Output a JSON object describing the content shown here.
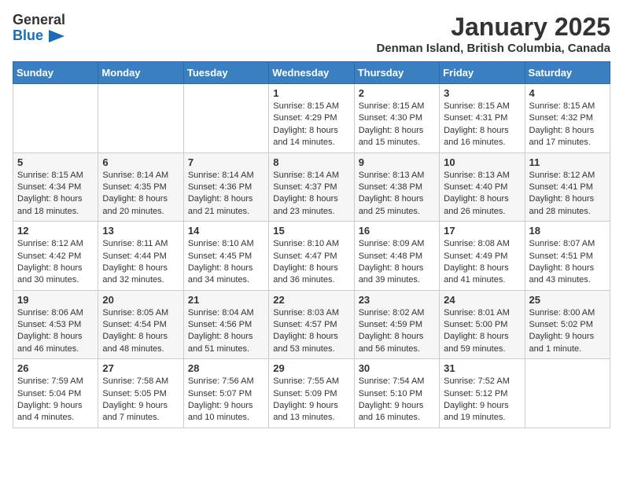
{
  "header": {
    "logo_general": "General",
    "logo_blue": "Blue",
    "month": "January 2025",
    "location": "Denman Island, British Columbia, Canada"
  },
  "weekdays": [
    "Sunday",
    "Monday",
    "Tuesday",
    "Wednesday",
    "Thursday",
    "Friday",
    "Saturday"
  ],
  "weeks": [
    [
      {
        "day": "",
        "info": ""
      },
      {
        "day": "",
        "info": ""
      },
      {
        "day": "",
        "info": ""
      },
      {
        "day": "1",
        "info": "Sunrise: 8:15 AM\nSunset: 4:29 PM\nDaylight: 8 hours\nand 14 minutes."
      },
      {
        "day": "2",
        "info": "Sunrise: 8:15 AM\nSunset: 4:30 PM\nDaylight: 8 hours\nand 15 minutes."
      },
      {
        "day": "3",
        "info": "Sunrise: 8:15 AM\nSunset: 4:31 PM\nDaylight: 8 hours\nand 16 minutes."
      },
      {
        "day": "4",
        "info": "Sunrise: 8:15 AM\nSunset: 4:32 PM\nDaylight: 8 hours\nand 17 minutes."
      }
    ],
    [
      {
        "day": "5",
        "info": "Sunrise: 8:15 AM\nSunset: 4:34 PM\nDaylight: 8 hours\nand 18 minutes."
      },
      {
        "day": "6",
        "info": "Sunrise: 8:14 AM\nSunset: 4:35 PM\nDaylight: 8 hours\nand 20 minutes."
      },
      {
        "day": "7",
        "info": "Sunrise: 8:14 AM\nSunset: 4:36 PM\nDaylight: 8 hours\nand 21 minutes."
      },
      {
        "day": "8",
        "info": "Sunrise: 8:14 AM\nSunset: 4:37 PM\nDaylight: 8 hours\nand 23 minutes."
      },
      {
        "day": "9",
        "info": "Sunrise: 8:13 AM\nSunset: 4:38 PM\nDaylight: 8 hours\nand 25 minutes."
      },
      {
        "day": "10",
        "info": "Sunrise: 8:13 AM\nSunset: 4:40 PM\nDaylight: 8 hours\nand 26 minutes."
      },
      {
        "day": "11",
        "info": "Sunrise: 8:12 AM\nSunset: 4:41 PM\nDaylight: 8 hours\nand 28 minutes."
      }
    ],
    [
      {
        "day": "12",
        "info": "Sunrise: 8:12 AM\nSunset: 4:42 PM\nDaylight: 8 hours\nand 30 minutes."
      },
      {
        "day": "13",
        "info": "Sunrise: 8:11 AM\nSunset: 4:44 PM\nDaylight: 8 hours\nand 32 minutes."
      },
      {
        "day": "14",
        "info": "Sunrise: 8:10 AM\nSunset: 4:45 PM\nDaylight: 8 hours\nand 34 minutes."
      },
      {
        "day": "15",
        "info": "Sunrise: 8:10 AM\nSunset: 4:47 PM\nDaylight: 8 hours\nand 36 minutes."
      },
      {
        "day": "16",
        "info": "Sunrise: 8:09 AM\nSunset: 4:48 PM\nDaylight: 8 hours\nand 39 minutes."
      },
      {
        "day": "17",
        "info": "Sunrise: 8:08 AM\nSunset: 4:49 PM\nDaylight: 8 hours\nand 41 minutes."
      },
      {
        "day": "18",
        "info": "Sunrise: 8:07 AM\nSunset: 4:51 PM\nDaylight: 8 hours\nand 43 minutes."
      }
    ],
    [
      {
        "day": "19",
        "info": "Sunrise: 8:06 AM\nSunset: 4:53 PM\nDaylight: 8 hours\nand 46 minutes."
      },
      {
        "day": "20",
        "info": "Sunrise: 8:05 AM\nSunset: 4:54 PM\nDaylight: 8 hours\nand 48 minutes."
      },
      {
        "day": "21",
        "info": "Sunrise: 8:04 AM\nSunset: 4:56 PM\nDaylight: 8 hours\nand 51 minutes."
      },
      {
        "day": "22",
        "info": "Sunrise: 8:03 AM\nSunset: 4:57 PM\nDaylight: 8 hours\nand 53 minutes."
      },
      {
        "day": "23",
        "info": "Sunrise: 8:02 AM\nSunset: 4:59 PM\nDaylight: 8 hours\nand 56 minutes."
      },
      {
        "day": "24",
        "info": "Sunrise: 8:01 AM\nSunset: 5:00 PM\nDaylight: 8 hours\nand 59 minutes."
      },
      {
        "day": "25",
        "info": "Sunrise: 8:00 AM\nSunset: 5:02 PM\nDaylight: 9 hours\nand 1 minute."
      }
    ],
    [
      {
        "day": "26",
        "info": "Sunrise: 7:59 AM\nSunset: 5:04 PM\nDaylight: 9 hours\nand 4 minutes."
      },
      {
        "day": "27",
        "info": "Sunrise: 7:58 AM\nSunset: 5:05 PM\nDaylight: 9 hours\nand 7 minutes."
      },
      {
        "day": "28",
        "info": "Sunrise: 7:56 AM\nSunset: 5:07 PM\nDaylight: 9 hours\nand 10 minutes."
      },
      {
        "day": "29",
        "info": "Sunrise: 7:55 AM\nSunset: 5:09 PM\nDaylight: 9 hours\nand 13 minutes."
      },
      {
        "day": "30",
        "info": "Sunrise: 7:54 AM\nSunset: 5:10 PM\nDaylight: 9 hours\nand 16 minutes."
      },
      {
        "day": "31",
        "info": "Sunrise: 7:52 AM\nSunset: 5:12 PM\nDaylight: 9 hours\nand 19 minutes."
      },
      {
        "day": "",
        "info": ""
      }
    ]
  ]
}
